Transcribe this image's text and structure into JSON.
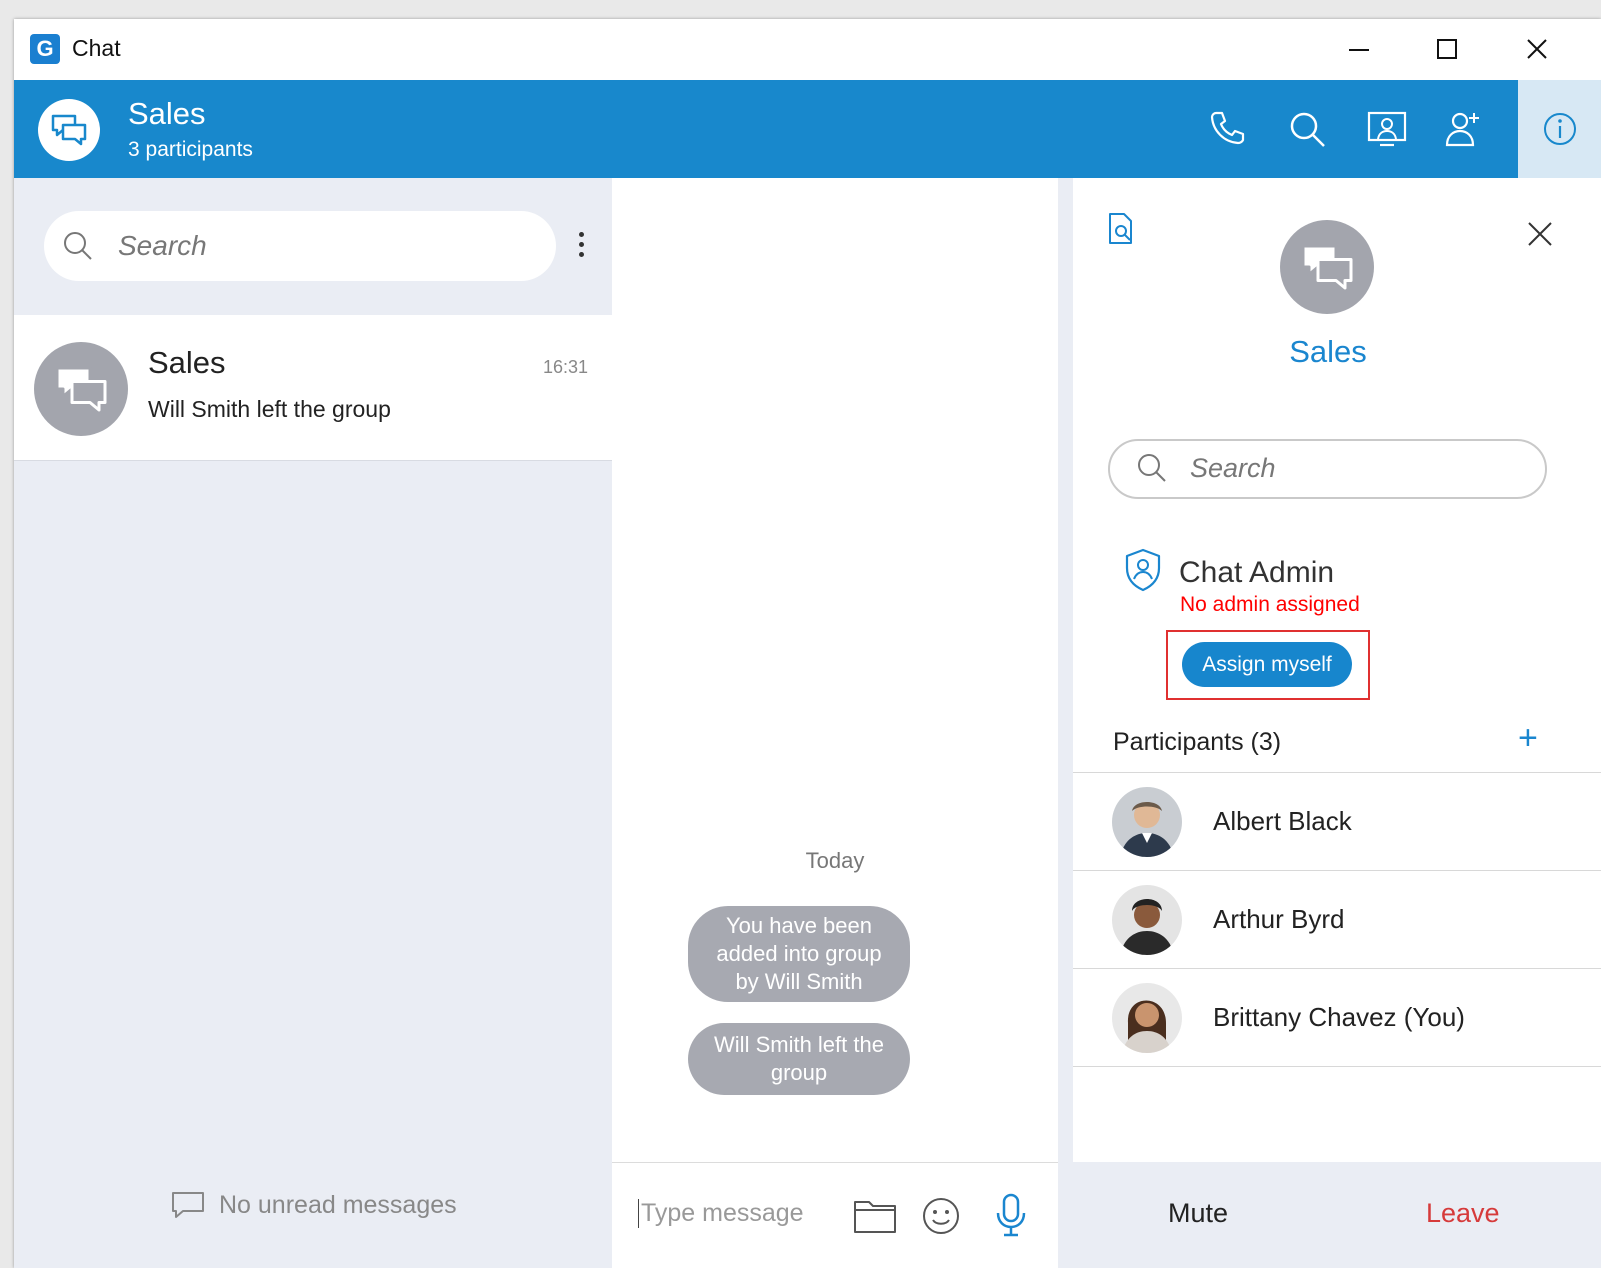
{
  "window": {
    "app_icon_letter": "G",
    "title": "Chat"
  },
  "header": {
    "title": "Sales",
    "subtitle": "3 participants",
    "icons": [
      "phone-icon",
      "search-icon",
      "screen-share-icon",
      "add-user-icon",
      "info-icon"
    ]
  },
  "sidebar": {
    "search_placeholder": "Search",
    "conversations": [
      {
        "name": "Sales",
        "time": "16:31",
        "last_message": "Will Smith left the group"
      }
    ],
    "footer_text": "No unread messages"
  },
  "chat": {
    "date_separator": "Today",
    "system_messages": [
      "You have been added into group by Will Smith",
      "Will Smith left the the group"
    ],
    "system_messages_lines": [
      [
        "You have been",
        "added into group",
        "by Will Smith"
      ],
      [
        "Will Smith left the",
        "group"
      ]
    ],
    "composer_placeholder": "Type message"
  },
  "details": {
    "title": "Sales",
    "search_placeholder": "Search",
    "admin_title": "Chat Admin",
    "admin_warning": "No admin assigned",
    "assign_button": "Assign myself",
    "participants_title": "Participants (3)",
    "add_symbol": "+",
    "participants": [
      {
        "name": "Albert Black"
      },
      {
        "name": "Arthur Byrd"
      },
      {
        "name": "Brittany Chavez (You)"
      }
    ],
    "mute_label": "Mute",
    "leave_label": "Leave"
  },
  "colors": {
    "accent": "#1888cc",
    "warning": "#ff0000",
    "leave": "#d63a3a"
  }
}
